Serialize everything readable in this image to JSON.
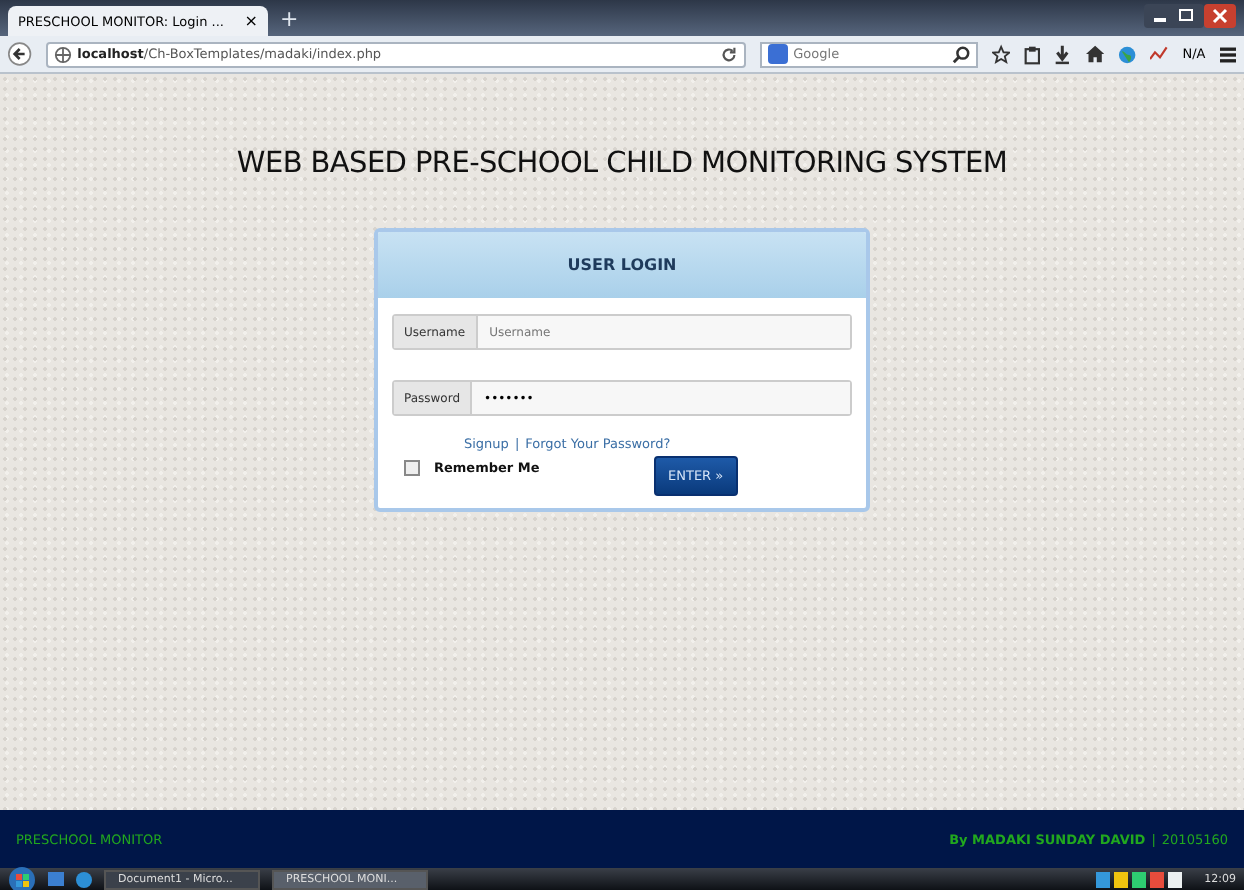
{
  "browser": {
    "tab_title": "PRESCHOOL MONITOR: Login ...",
    "tab_close": "×",
    "new_tab": "+",
    "url_host": "localhost",
    "url_path": "/Ch-BoxTemplates/madaki/index.php",
    "search_placeholder": "Google",
    "na": "N/A"
  },
  "page": {
    "heading": "WEB BASED PRE-SCHOOL CHILD MONITORING SYSTEM"
  },
  "login": {
    "title": "USER LOGIN",
    "fields": [
      {
        "label": "Username",
        "placeholder": "Username"
      },
      {
        "label": "Password",
        "value": "•••••••"
      }
    ],
    "signup": "Signup",
    "separator": "|",
    "forgot": "Forgot Your Password?",
    "remember": {
      "label": "Remember Me",
      "checked": false
    },
    "submit": "ENTER »"
  },
  "footer": {
    "left": "PRESCHOOL MONITOR",
    "author": "By MADAKI SUNDAY DAVID",
    "separator": "|",
    "id": "20105160"
  },
  "taskbar": {
    "windows": [
      {
        "label": "Document1 - Micro...",
        "selected": false
      },
      {
        "label": "PRESCHOOL MONI...",
        "selected": true
      }
    ],
    "clock": "12:09"
  }
}
